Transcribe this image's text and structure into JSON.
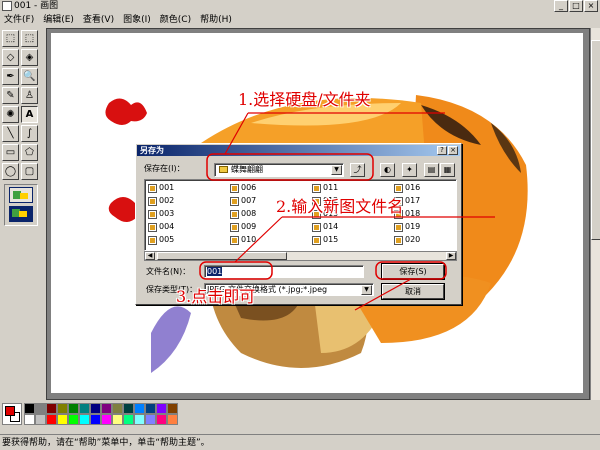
{
  "window": {
    "title": "001 - 画图",
    "min_label": "_",
    "max_label": "□",
    "close_label": "×"
  },
  "menubar": [
    {
      "label": "文件(F)"
    },
    {
      "label": "编辑(E)"
    },
    {
      "label": "查看(V)"
    },
    {
      "label": "图象(I)"
    },
    {
      "label": "颜色(C)"
    },
    {
      "label": "帮助(H)"
    }
  ],
  "tools": [
    {
      "glyph": "⬚",
      "icon": "free-select-icon"
    },
    {
      "glyph": "⬚",
      "icon": "rect-select-icon"
    },
    {
      "glyph": "◇",
      "icon": "eraser-icon"
    },
    {
      "glyph": "◈",
      "icon": "fill-icon"
    },
    {
      "glyph": "✒",
      "icon": "pick-color-icon"
    },
    {
      "glyph": "🔍",
      "icon": "magnifier-icon"
    },
    {
      "glyph": "✎",
      "icon": "pencil-icon"
    },
    {
      "glyph": "♙",
      "icon": "brush-icon"
    },
    {
      "glyph": "✺",
      "icon": "airbrush-icon"
    },
    {
      "glyph": "A",
      "icon": "text-icon"
    },
    {
      "glyph": "╲",
      "icon": "line-icon"
    },
    {
      "glyph": "∫",
      "icon": "curve-icon"
    },
    {
      "glyph": "▭",
      "icon": "rectangle-icon"
    },
    {
      "glyph": "⬠",
      "icon": "polygon-icon"
    },
    {
      "glyph": "◯",
      "icon": "ellipse-icon"
    },
    {
      "glyph": "▢",
      "icon": "rounded-rect-icon"
    }
  ],
  "palette": {
    "foreground": "#e00000",
    "background": "#ffffff",
    "colors": [
      "#000000",
      "#808080",
      "#800000",
      "#808000",
      "#008000",
      "#008080",
      "#000080",
      "#800080",
      "#808040",
      "#004040",
      "#0080ff",
      "#004080",
      "#8000ff",
      "#804000",
      "#ffffff",
      "#c0c0c0",
      "#ff0000",
      "#ffff00",
      "#00ff00",
      "#00ffff",
      "#0000ff",
      "#ff00ff",
      "#ffff80",
      "#00ff80",
      "#80ffff",
      "#8080ff",
      "#ff0080",
      "#ff8040"
    ]
  },
  "statusbar": {
    "text": "要获得帮助，请在“帮助”菜单中，单击“帮助主题”。"
  },
  "dialog": {
    "title": "另存为",
    "help_label": "?",
    "close_label": "×",
    "save_in_label": "保存在(I)：",
    "save_in_value": "蝶舞翩翩",
    "files": [
      [
        "001",
        "002",
        "003",
        "004",
        "005"
      ],
      [
        "006",
        "007",
        "008",
        "009",
        "010"
      ],
      [
        "011",
        "012",
        "013",
        "014",
        "015"
      ],
      [
        "016",
        "017",
        "018",
        "019",
        "020"
      ]
    ],
    "filename_label": "文件名(N)：",
    "filename_value": "001",
    "filetype_label": "保存类型(T)：",
    "filetype_value": "JPEG 文件交换格式 (*.jpg;*.jpeg",
    "save_button": "保存(S)",
    "cancel_button": "取消"
  },
  "annotations": {
    "step1": "1.选择硬盘/文件夹",
    "step2": "2.输入新图文件名",
    "step3": "3.点击即可"
  }
}
